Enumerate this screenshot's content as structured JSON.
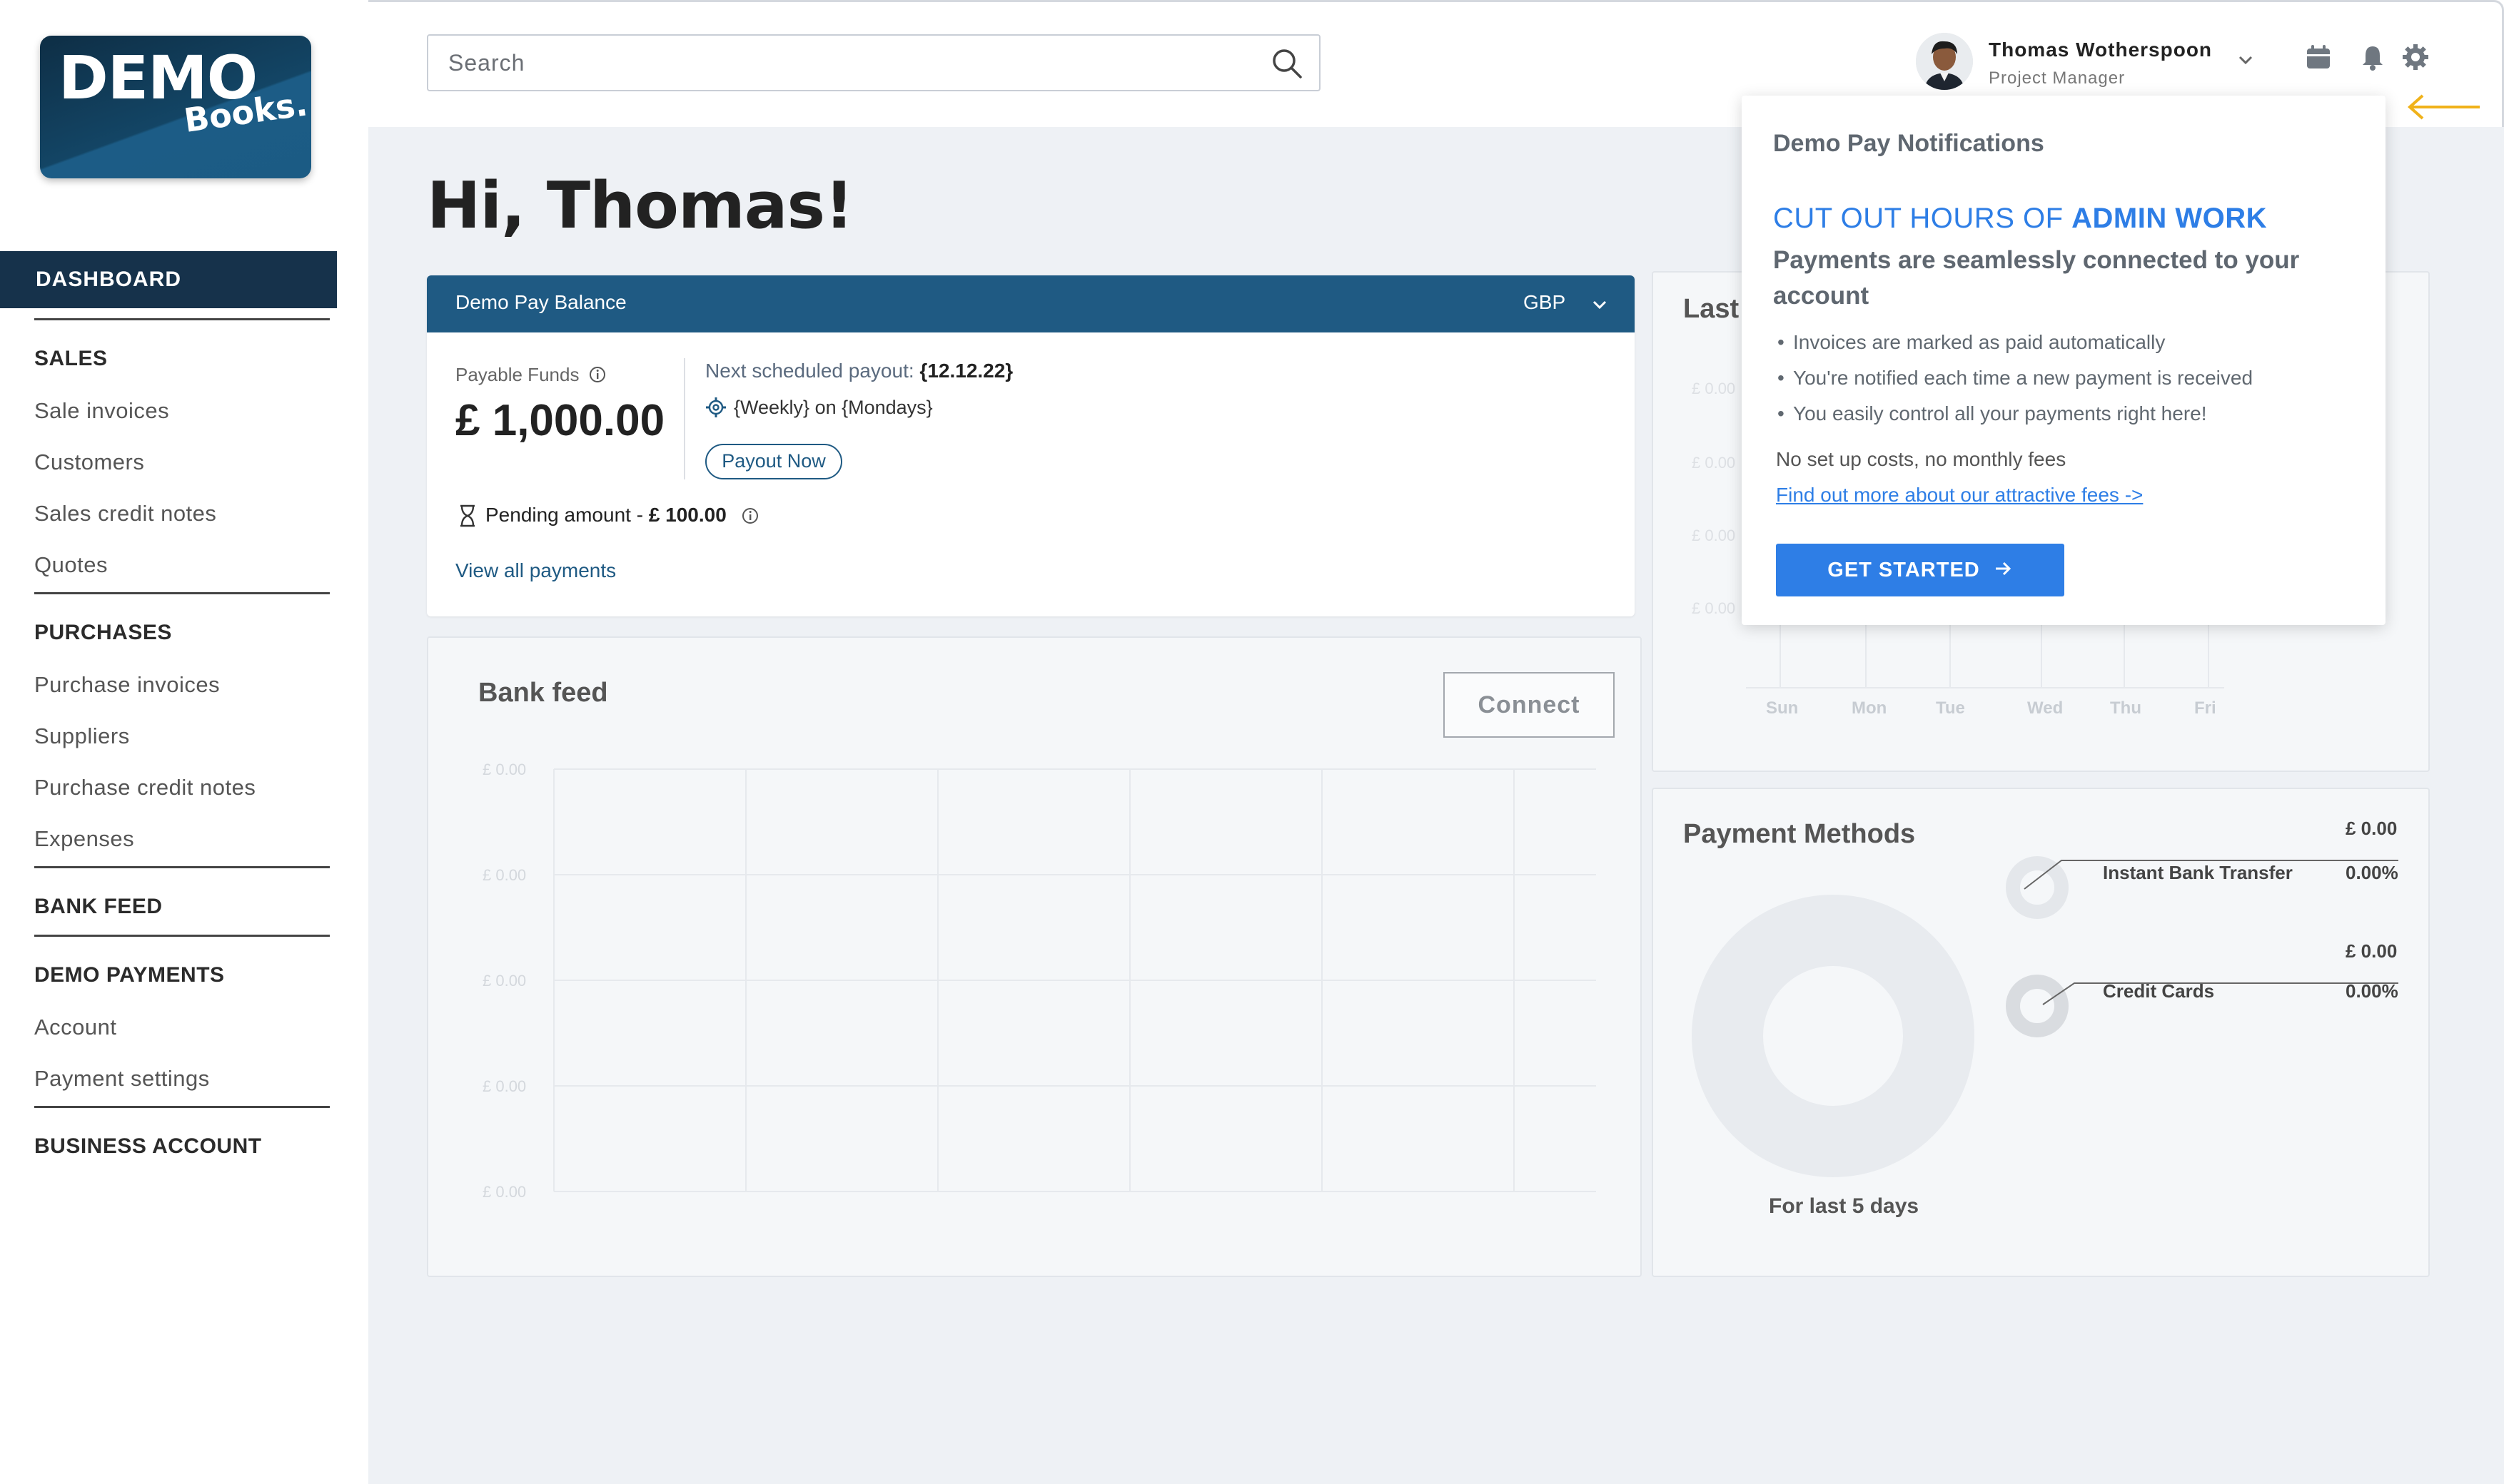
{
  "brand": {
    "logo_main": "DEMO",
    "logo_sub": "Books."
  },
  "sidebar": {
    "active": "DASHBOARD",
    "sections": [
      {
        "heading": "SALES",
        "items": [
          "Sale invoices",
          "Customers",
          "Sales credit notes",
          "Quotes"
        ]
      },
      {
        "heading": "PURCHASES",
        "items": [
          "Purchase invoices",
          "Suppliers",
          "Purchase credit notes",
          "Expenses"
        ]
      },
      {
        "heading": "BANK FEED",
        "items": []
      },
      {
        "heading": "DEMO PAYMENTS",
        "items": [
          "Account",
          "Payment settings"
        ]
      },
      {
        "heading": "BUSINESS ACCOUNT",
        "items": []
      }
    ]
  },
  "header": {
    "search_placeholder": "Search",
    "user_name": "Thomas Wotherspoon",
    "user_role": "Project Manager",
    "icons": [
      "calendar-icon",
      "bell-icon",
      "gear-icon"
    ]
  },
  "greeting": "Hi, Thomas!",
  "balance": {
    "title": "Demo Pay Balance",
    "currency": "GBP",
    "funds_label": "Payable Funds",
    "funds_value": "£ 1,000.00",
    "payout_label": "Next scheduled payout:",
    "payout_date": "{12.12.22}",
    "schedule": "{Weekly} on {Mondays}",
    "payout_button": "Payout Now",
    "pending_label": "Pending amount - ",
    "pending_value": "£ 100.00",
    "view_all": "View all payments"
  },
  "bank_feed": {
    "title": "Bank feed",
    "connect": "Connect",
    "y_labels": [
      "£ 0.00",
      "£ 0.00",
      "£ 0.00",
      "£ 0.00",
      "£ 0.00"
    ]
  },
  "last_days": {
    "title": "Last",
    "y_labels": [
      "£ 0.00",
      "£ 0.00",
      "£ 0.00",
      "£ 0.00"
    ],
    "days": [
      "Sun",
      "Mon",
      "Tue",
      "Wed",
      "Thu",
      "Fri"
    ]
  },
  "payment_methods": {
    "title": "Payment Methods",
    "caption": "For last 5 days",
    "methods": [
      {
        "name": "Instant Bank Transfer",
        "amount": "£ 0.00",
        "percent": "0.00%"
      },
      {
        "name": "Credit Cards",
        "amount": "£ 0.00",
        "percent": "0.00%"
      }
    ]
  },
  "notification": {
    "title": "Demo Pay Notifications",
    "headline_prefix": "CUT OUT HOURS OF ",
    "headline_bold": "ADMIN WORK",
    "subheadline": "Payments are seamlessly connected to your account",
    "bullets": [
      "Invoices are marked as paid automatically",
      "You're notified each time a new payment is received",
      "You easily control all your payments right here!"
    ],
    "no_fees": "No set up costs, no monthly fees",
    "link": "Find out more about our attractive fees ->",
    "cta": "GET STARTED"
  },
  "colors": {
    "brand_dark": "#16324b",
    "card_header": "#1f5a83",
    "accent_blue": "#2e7ee6",
    "pointer_arrow": "#f0b21a"
  }
}
